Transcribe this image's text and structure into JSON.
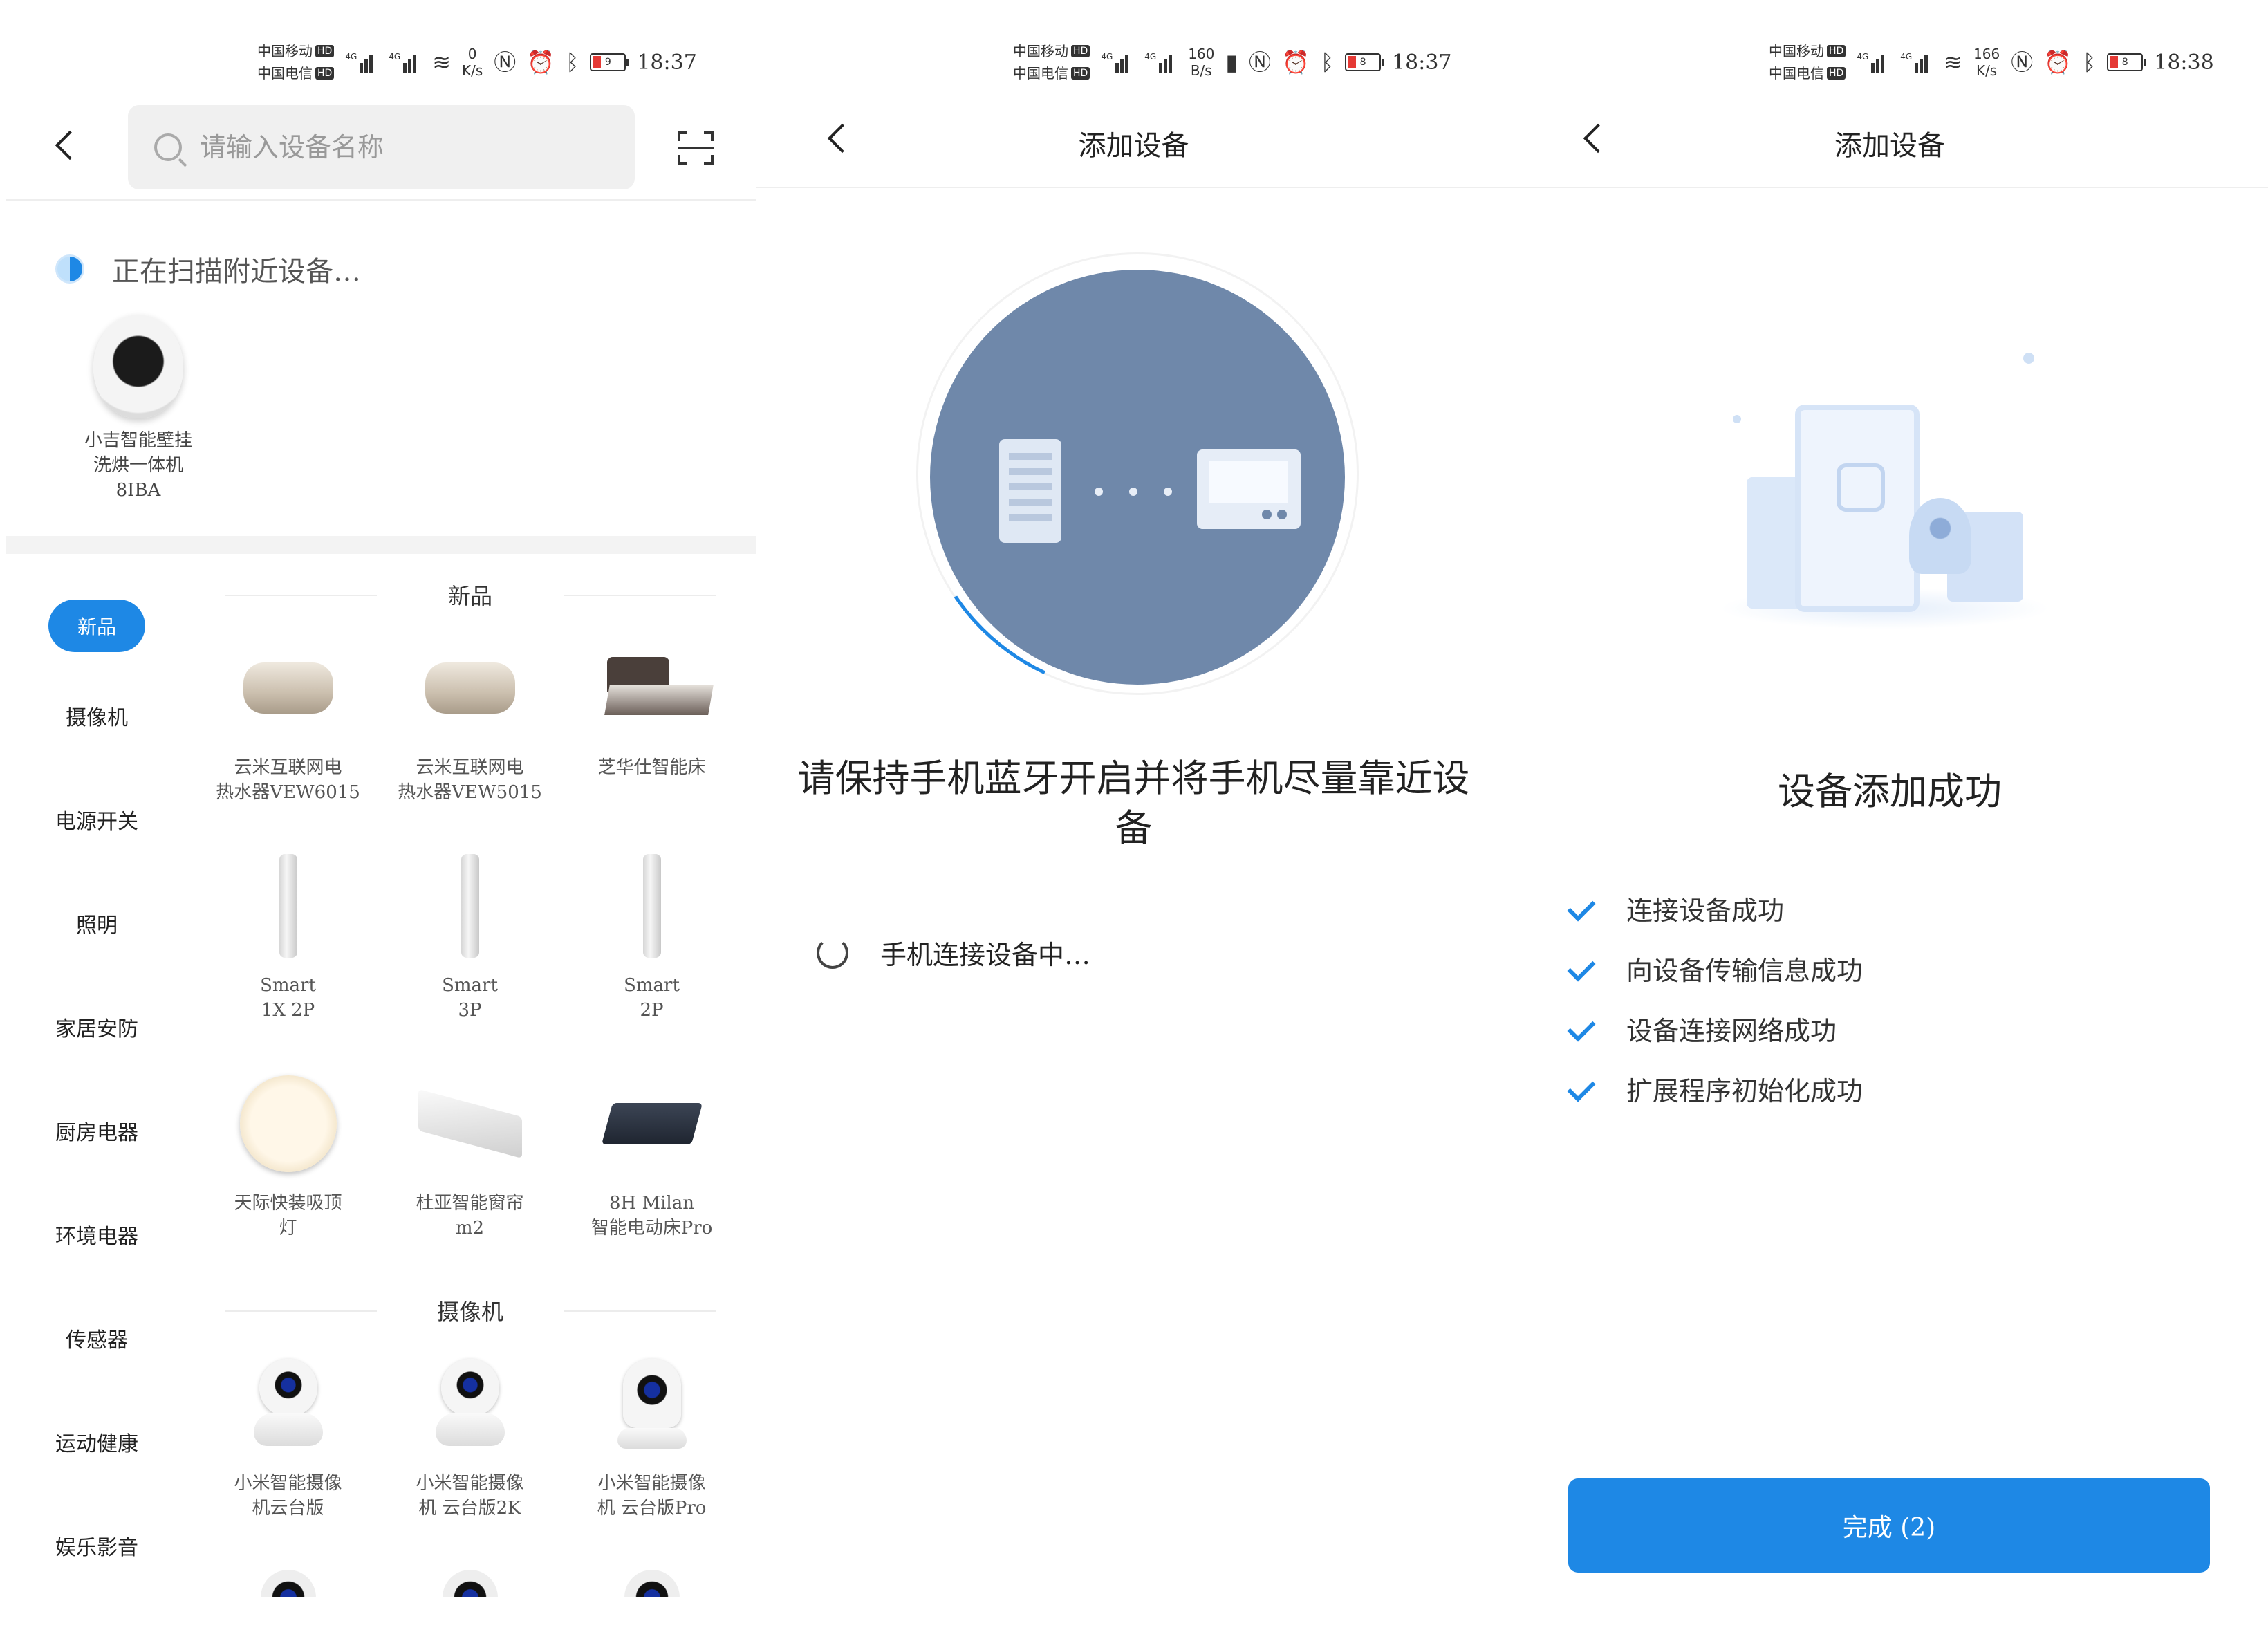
{
  "status_bar": {
    "carrier1": "中国移动",
    "carrier2": "中国电信",
    "hd": "HD",
    "net": "4G",
    "panels": [
      {
        "speed_value": "0",
        "speed_unit": "K/s",
        "battery": "9",
        "time": "18:37"
      },
      {
        "speed_value": "160",
        "speed_unit": "B/s",
        "battery": "8",
        "time": "18:37"
      },
      {
        "speed_value": "166",
        "speed_unit": "K/s",
        "battery": "8",
        "time": "18:38"
      }
    ]
  },
  "panel1": {
    "search_placeholder": "请输入设备名称",
    "scanning_text": "正在扫描附近设备…",
    "nearby_device": "小吉智能壁挂\n洗烘一体机\n8IBA",
    "categories": [
      "新品",
      "摄像机",
      "电源开关",
      "照明",
      "家居安防",
      "厨房电器",
      "环境电器",
      "传感器",
      "运动健康",
      "娱乐影音"
    ],
    "sections": [
      {
        "title": "新品",
        "items": [
          {
            "label": "云米互联网电\n热水器VEW6015",
            "icon": "water-heater"
          },
          {
            "label": "云米互联网电\n热水器VEW5015",
            "icon": "water-heater"
          },
          {
            "label": "芝华仕智能床",
            "icon": "smart-bed"
          },
          {
            "label": "Smart\n1X 2P",
            "icon": "tower-ac"
          },
          {
            "label": "Smart\n3P",
            "icon": "tower-ac"
          },
          {
            "label": "Smart\n2P",
            "icon": "tower-ac"
          },
          {
            "label": "天际快装吸顶\n灯",
            "icon": "ceiling-lamp"
          },
          {
            "label": "杜亚智能窗帘\nm2",
            "icon": "curtain-motor"
          },
          {
            "label": "8H Milan\n智能电动床Pro",
            "icon": "electric-bed"
          }
        ]
      },
      {
        "title": "摄像机",
        "items": [
          {
            "label": "小米智能摄像\n机云台版",
            "icon": "ptz-camera"
          },
          {
            "label": "小米智能摄像\n机 云台版2K",
            "icon": "ptz-camera"
          },
          {
            "label": "小米智能摄像\n机  云台版Pro",
            "icon": "tall-camera"
          }
        ]
      }
    ]
  },
  "panel2": {
    "title": "添加设备",
    "instruction": "请保持手机蓝牙开启并将手机尽量靠近设备",
    "status": "手机连接设备中…"
  },
  "panel3": {
    "title": "添加设备",
    "success": "设备添加成功",
    "steps": [
      "连接设备成功",
      "向设备传输信息成功",
      "设备连接网络成功",
      "扩展程序初始化成功"
    ],
    "done_button": "完成 (2)"
  },
  "colors": {
    "accent": "#1e88e5",
    "pair_circle": "#6f88aa"
  }
}
